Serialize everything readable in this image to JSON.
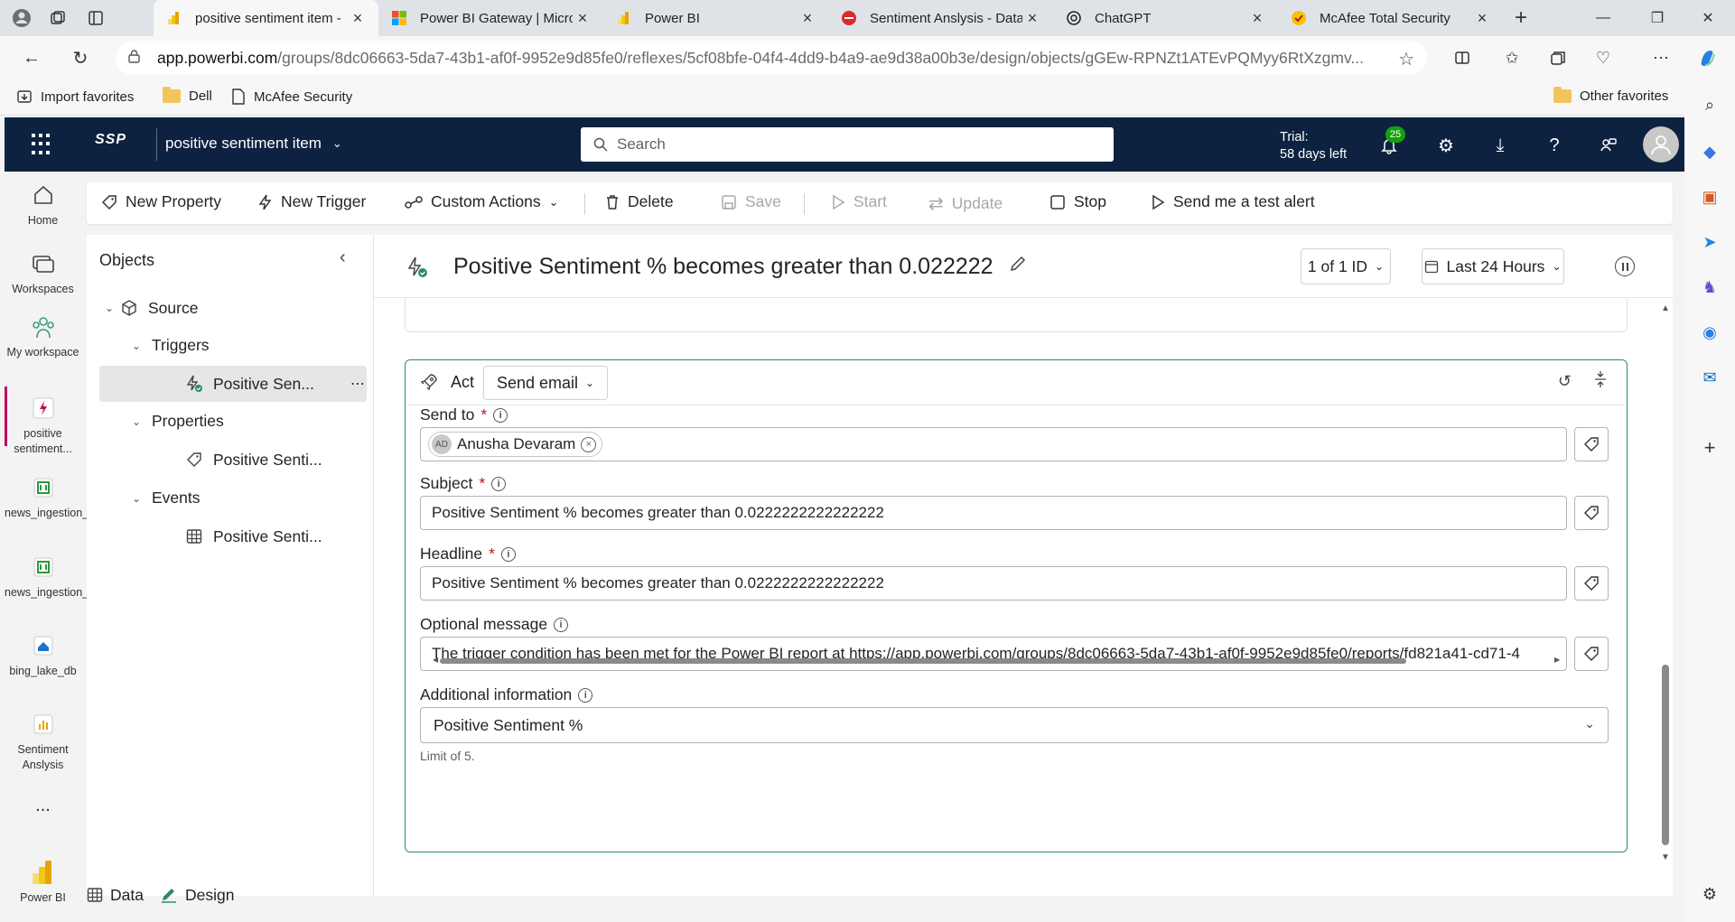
{
  "browser": {
    "tabs": [
      {
        "label": "positive sentiment item -",
        "icon": "powerbi-icon",
        "active": true
      },
      {
        "label": "Power BI Gateway | Micro",
        "icon": "microsoft-icon",
        "active": false
      },
      {
        "label": "Power BI",
        "icon": "powerbi-icon",
        "active": false
      },
      {
        "label": "Sentiment Anslysis - Data",
        "icon": "red-app-icon",
        "active": false
      },
      {
        "label": "ChatGPT",
        "icon": "chatgpt-icon",
        "active": false
      },
      {
        "label": "McAfee Total Security",
        "icon": "mcafee-icon",
        "active": false
      }
    ],
    "url_host": "app.powerbi.com",
    "url_path": "/groups/8dc06663-5da7-43b1-af0f-9952e9d85fe0/reflexes/5cf08bfe-04f4-4dd9-b4a9-ae9d38a00b3e/design/objects/gGEw-RPNZt1ATEvPQMyy6RtXzgmv...",
    "favorites": [
      "Import favorites",
      "Dell",
      "McAfee Security"
    ],
    "other_favorites": "Other favorites"
  },
  "header": {
    "logo": "SSP",
    "workspace_title": "positive sentiment item",
    "search_placeholder": "Search",
    "trial_line1": "Trial:",
    "trial_line2": "58 days left",
    "notification_count": "25"
  },
  "leftnav": {
    "items": [
      {
        "label": "Home"
      },
      {
        "label": "Workspaces"
      },
      {
        "label": "My workspace"
      },
      {
        "label": "positive sentiment..."
      },
      {
        "label": "news_ingestion_pipelin..."
      },
      {
        "label": "news_ingestion_pipeline"
      },
      {
        "label": "bing_lake_db"
      },
      {
        "label": "Sentiment Anslysis"
      }
    ],
    "more": "...",
    "footer": "Power BI"
  },
  "ribbon": {
    "new_property": "New Property",
    "new_trigger": "New Trigger",
    "custom_actions": "Custom Actions",
    "delete": "Delete",
    "save": "Save",
    "start": "Start",
    "update": "Update",
    "stop": "Stop",
    "send_test": "Send me a test alert"
  },
  "objects": {
    "title": "Objects",
    "source": "Source",
    "triggers": "Triggers",
    "trigger_item": "Positive Sen...",
    "properties": "Properties",
    "property_item": "Positive Senti...",
    "events": "Events",
    "event_item": "Positive Senti..."
  },
  "main": {
    "title": "Positive Sentiment % becomes greater than 0.022222",
    "id_selector": "1 of 1 ID",
    "time_range": "Last 24 Hours"
  },
  "act": {
    "label": "Act",
    "action": "Send email",
    "send_to_label": "Send to",
    "recipient_initials": "AD",
    "recipient_name": "Anusha Devaram",
    "subject_label": "Subject",
    "subject_value": "Positive Sentiment % becomes greater than 0.0222222222222222",
    "headline_label": "Headline",
    "headline_value": "Positive Sentiment % becomes greater than 0.0222222222222222",
    "optional_label": "Optional message",
    "optional_value": "The trigger condition has been met for the Power BI report at https://app.powerbi.com/groups/8dc06663-5da7-43b1-af0f-9952e9d85fe0/reports/fd821a41-cd71-4",
    "additional_label": "Additional information",
    "additional_value": "Positive Sentiment %",
    "limit_hint": "Limit of 5."
  },
  "bottom": {
    "data_tab": "Data",
    "design_tab": "Design"
  },
  "colors": {
    "header_bg": "#0d2240",
    "accent_green": "#2b8a6e",
    "required_red": "#c50f1f",
    "active_marker": "#c00b5c"
  }
}
